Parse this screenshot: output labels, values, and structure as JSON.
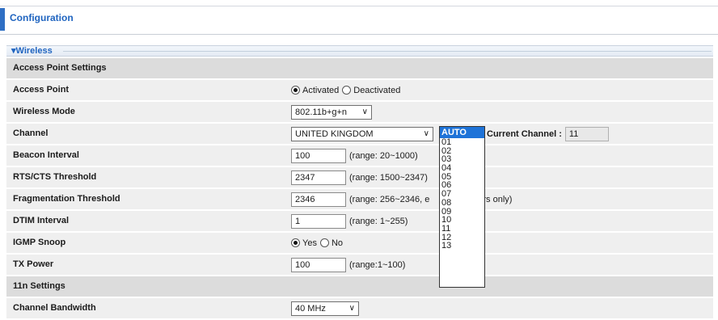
{
  "header": {
    "title": "Configuration"
  },
  "section": {
    "label": "Wireless",
    "arrow": "▾"
  },
  "groups": {
    "access_point": "Access Point Settings",
    "n11": "11n Settings"
  },
  "rows": {
    "access_point": {
      "label": "Access Point",
      "opt_on": "Activated",
      "opt_off": "Deactivated",
      "selected": "Activated"
    },
    "wireless_mode": {
      "label": "Wireless Mode",
      "value": "802.11b+g+n"
    },
    "channel": {
      "label": "Channel",
      "country": "UNITED KINGDOM",
      "current_label": "Current Channel :",
      "current_value": "11"
    },
    "beacon": {
      "label": "Beacon Interval",
      "value": "100",
      "hint": "(range: 20~1000)"
    },
    "rts": {
      "label": "RTS/CTS Threshold",
      "value": "2347",
      "hint": "(range: 1500~2347)"
    },
    "frag": {
      "label": "Fragmentation Threshold",
      "value": "2346",
      "hint_a": "(range: 256~2346, e",
      "hint_b": "rs only)"
    },
    "dtim": {
      "label": "DTIM Interval",
      "value": "1",
      "hint": "(range: 1~255)"
    },
    "igmp": {
      "label": "IGMP Snoop",
      "opt_yes": "Yes",
      "opt_no": "No",
      "selected": "Yes"
    },
    "tx": {
      "label": "TX Power",
      "value": "100",
      "hint": "(range:1~100)"
    },
    "bandwidth": {
      "label": "Channel Bandwidth",
      "value": "40 MHz"
    }
  },
  "channel_dropdown": {
    "selected": "AUTO",
    "options": [
      "AUTO",
      "01",
      "02",
      "03",
      "04",
      "05",
      "06",
      "07",
      "08",
      "09",
      "10",
      "11",
      "12",
      "13"
    ]
  }
}
